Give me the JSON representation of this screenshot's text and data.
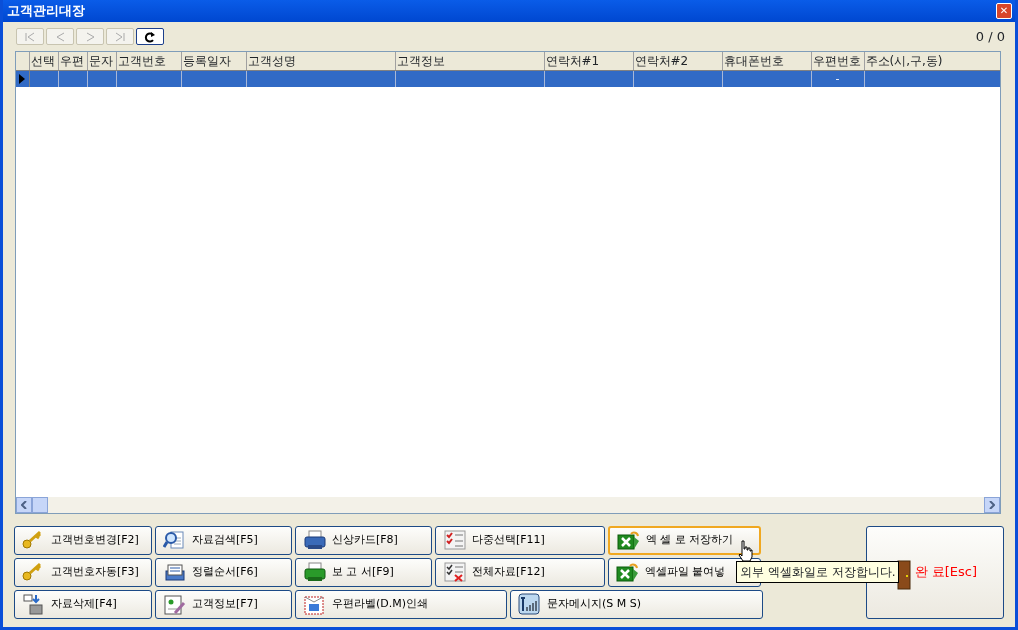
{
  "window": {
    "title": "고객관리대장",
    "close": "✕"
  },
  "navigator": {
    "buttons": [
      {
        "kind": "first",
        "disabled": true
      },
      {
        "kind": "prev",
        "disabled": true
      },
      {
        "kind": "next",
        "disabled": true
      },
      {
        "kind": "last",
        "disabled": true
      },
      {
        "kind": "refresh",
        "disabled": false
      }
    ],
    "record_count": "0 / 0"
  },
  "table": {
    "columns": [
      "선택",
      "우편",
      "문자",
      "고객번호",
      "등록일자",
      "고객성명",
      "고객정보",
      "연락처#1",
      "연락처#2",
      "휴대폰번호",
      "우편번호",
      "주소(시,구,동)"
    ],
    "rows": [
      {
        "selected": true,
        "cells": [
          "",
          "",
          "",
          "",
          "",
          "",
          "",
          "",
          "",
          "",
          "-",
          ""
        ]
      }
    ]
  },
  "buttons": [
    [
      {
        "label": "고객번호변경[F2]",
        "kind": "key",
        "hovered": false
      },
      {
        "label": "자료검색[F5]",
        "kind": "search",
        "hovered": false
      },
      {
        "label": "신상카드[F8]",
        "kind": "printer",
        "hovered": false
      },
      {
        "label": "다중선택[F11]",
        "kind": "checklist",
        "hovered": false
      },
      {
        "label": "엑 셀 로 저장하기",
        "kind": "excel",
        "hovered": true
      }
    ],
    [
      {
        "label": "고객번호자동[F3]",
        "kind": "key",
        "hovered": false
      },
      {
        "label": "정렬순서[F6]",
        "kind": "sort",
        "hovered": false
      },
      {
        "label": "보 고 서[F9]",
        "kind": "printer-green",
        "hovered": false
      },
      {
        "label": "전체자료[F12]",
        "kind": "checklist-x",
        "hovered": false
      },
      {
        "label": "엑셀파일 붙여넣",
        "kind": "excel",
        "hovered": false
      }
    ],
    [
      {
        "label": "자료삭제[F4]",
        "kind": "delete",
        "hovered": false
      },
      {
        "label": "고객정보[F7]",
        "kind": "card",
        "hovered": false
      },
      {
        "label": "우편라벨(D.M)인쇄",
        "kind": "label",
        "hovered": false
      },
      {
        "label": "문자메시지(S M S)",
        "kind": "sms",
        "hovered": false
      }
    ]
  ],
  "exit_button": {
    "label": "완 료[Esc]"
  },
  "tooltip": "외부 엑셀화일로 저장합니다."
}
